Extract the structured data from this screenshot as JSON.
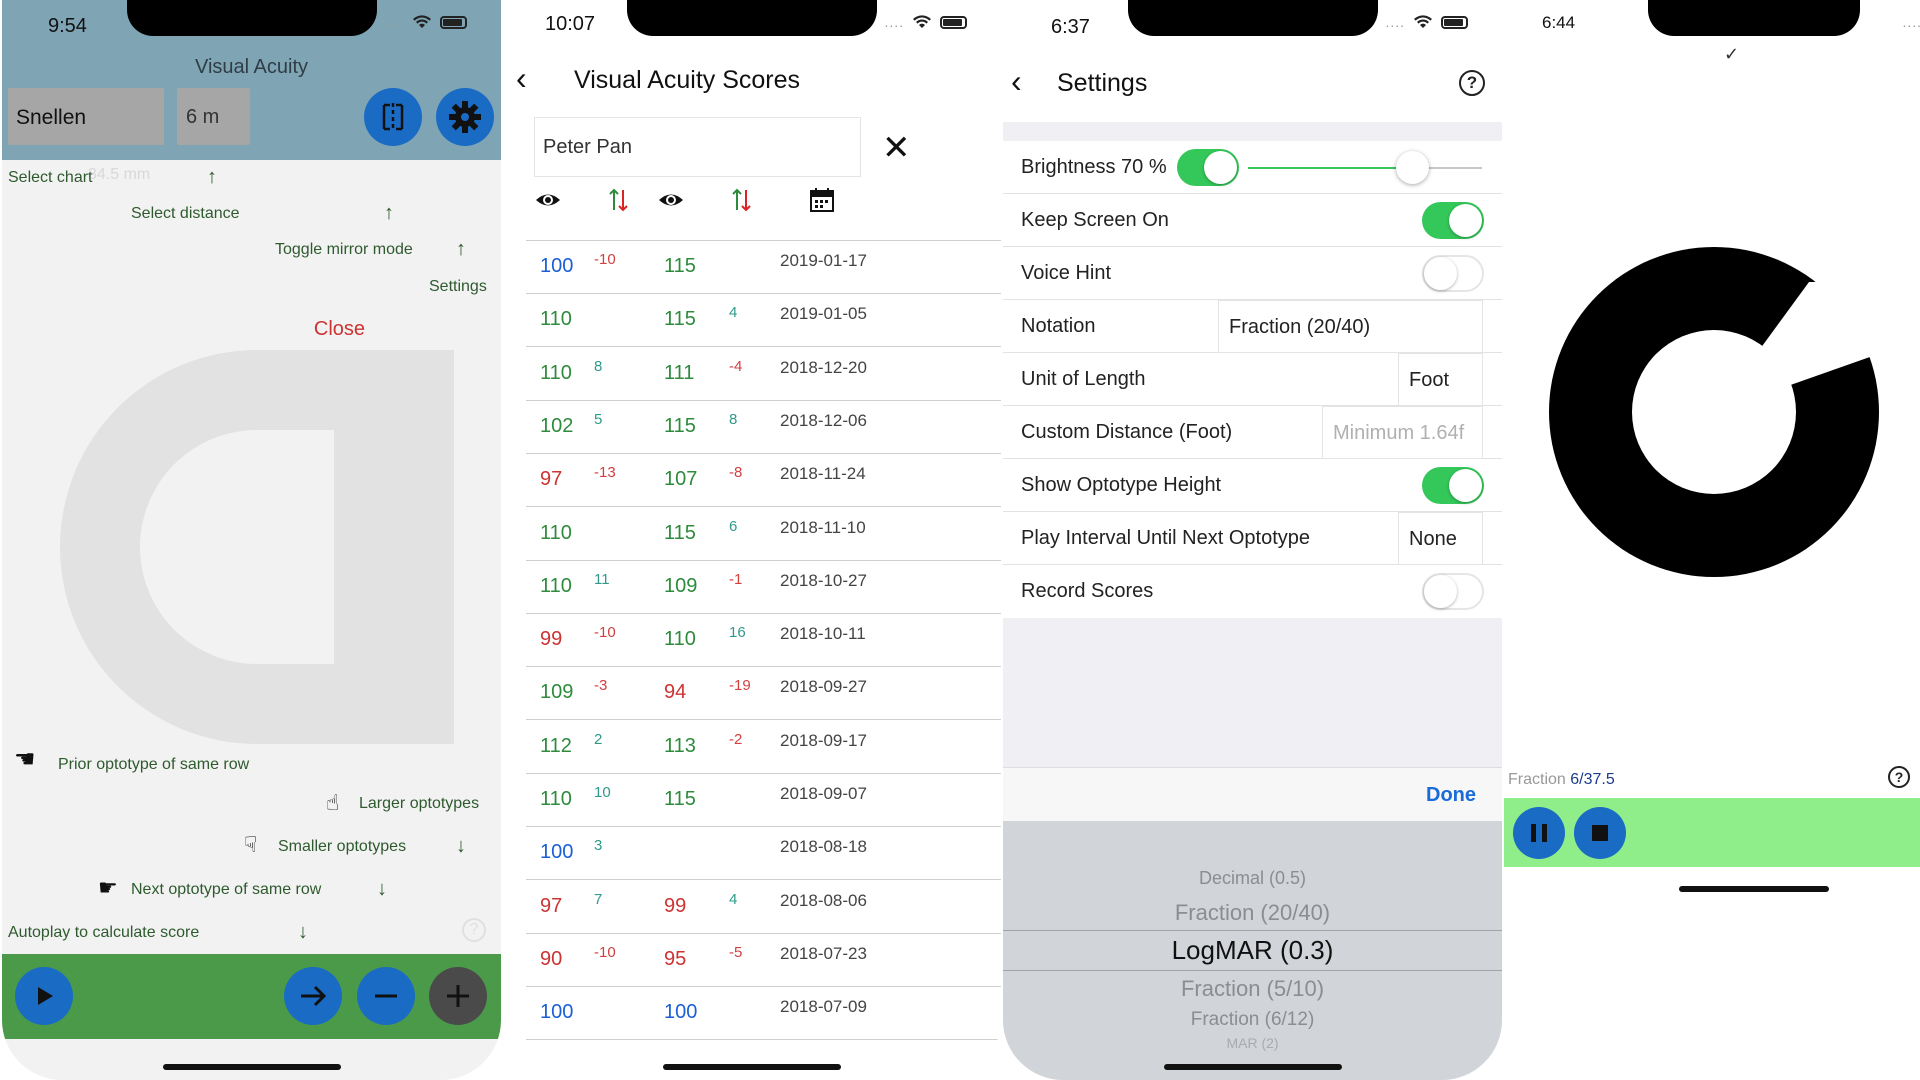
{
  "phone1": {
    "time": "9:54",
    "title": "Visual Acuity",
    "chart": "Snellen",
    "distance": "6 m",
    "hints": {
      "select_chart": "Select chart",
      "faded_size": "34.5 mm",
      "select_distance": "Select distance",
      "toggle_mirror": "Toggle mirror mode",
      "settings": "Settings",
      "close": "Close",
      "prior": "Prior optotype of same row",
      "larger": "Larger optotypes",
      "smaller": "Smaller optotypes",
      "next": "Next optotype of same row",
      "autoplay": "Autoplay to calculate score"
    },
    "icons": {
      "mirror": "mirror-toggle-icon",
      "settings": "gear-icon",
      "play": "play-icon",
      "next": "arrow-right-icon",
      "minus": "minus-icon",
      "plus": "plus-icon"
    },
    "colors": {
      "top_bar": "#7fa5b5",
      "bottom_bar": "#4a9a4a",
      "button": "#1a6bc4"
    }
  },
  "phone2": {
    "time": "10:07",
    "title": "Visual Acuity Scores",
    "patient_name": "Peter Pan",
    "column_icons": [
      "eye-icon",
      "change-arrows-icon",
      "eye-icon",
      "change-arrows-icon",
      "calendar-icon"
    ],
    "rows": [
      {
        "v1": "100",
        "c1": "blue",
        "d1": "-10",
        "dc1": "red",
        "v2": "115",
        "c2": "green",
        "d2": "",
        "dc2": "green",
        "date": "2019-01-17"
      },
      {
        "v1": "110",
        "c1": "green",
        "d1": "",
        "dc1": "green",
        "v2": "115",
        "c2": "green",
        "d2": "4",
        "dc2": "green",
        "date": "2019-01-05"
      },
      {
        "v1": "110",
        "c1": "green",
        "d1": "8",
        "dc1": "green",
        "v2": "111",
        "c2": "green",
        "d2": "-4",
        "dc2": "red",
        "date": "2018-12-20"
      },
      {
        "v1": "102",
        "c1": "green",
        "d1": "5",
        "dc1": "green",
        "v2": "115",
        "c2": "green",
        "d2": "8",
        "dc2": "green",
        "date": "2018-12-06"
      },
      {
        "v1": "97",
        "c1": "red",
        "d1": "-13",
        "dc1": "red",
        "v2": "107",
        "c2": "green",
        "d2": "-8",
        "dc2": "red",
        "date": "2018-11-24"
      },
      {
        "v1": "110",
        "c1": "green",
        "d1": "",
        "dc1": "green",
        "v2": "115",
        "c2": "green",
        "d2": "6",
        "dc2": "green",
        "date": "2018-11-10"
      },
      {
        "v1": "110",
        "c1": "green",
        "d1": "11",
        "dc1": "green",
        "v2": "109",
        "c2": "green",
        "d2": "-1",
        "dc2": "red",
        "date": "2018-10-27"
      },
      {
        "v1": "99",
        "c1": "red",
        "d1": "-10",
        "dc1": "red",
        "v2": "110",
        "c2": "green",
        "d2": "16",
        "dc2": "green",
        "date": "2018-10-11"
      },
      {
        "v1": "109",
        "c1": "green",
        "d1": "-3",
        "dc1": "red",
        "v2": "94",
        "c2": "red",
        "d2": "-19",
        "dc2": "red",
        "date": "2018-09-27"
      },
      {
        "v1": "112",
        "c1": "green",
        "d1": "2",
        "dc1": "green",
        "v2": "113",
        "c2": "green",
        "d2": "-2",
        "dc2": "red",
        "date": "2018-09-17"
      },
      {
        "v1": "110",
        "c1": "green",
        "d1": "10",
        "dc1": "green",
        "v2": "115",
        "c2": "green",
        "d2": "",
        "dc2": "green",
        "date": "2018-09-07"
      },
      {
        "v1": "100",
        "c1": "blue",
        "d1": "3",
        "dc1": "green",
        "v2": "",
        "c2": "green",
        "d2": "",
        "dc2": "green",
        "date": "2018-08-18"
      },
      {
        "v1": "97",
        "c1": "red",
        "d1": "7",
        "dc1": "green",
        "v2": "99",
        "c2": "red",
        "d2": "4",
        "dc2": "green",
        "date": "2018-08-06"
      },
      {
        "v1": "90",
        "c1": "red",
        "d1": "-10",
        "dc1": "red",
        "v2": "95",
        "c2": "red",
        "d2": "-5",
        "dc2": "red",
        "date": "2018-07-23"
      },
      {
        "v1": "100",
        "c1": "blue",
        "d1": "",
        "dc1": "green",
        "v2": "100",
        "c2": "blue",
        "d2": "",
        "dc2": "green",
        "date": "2018-07-09"
      }
    ]
  },
  "phone3": {
    "time": "6:37",
    "title": "Settings",
    "brightness_label": "Brightness 70 %",
    "brightness_value": 0.7,
    "keep_screen_on": "Keep Screen On",
    "voice_hint": "Voice Hint",
    "notation_label": "Notation",
    "notation_value": "Fraction (20/40)",
    "unit_label": "Unit of Length",
    "unit_value": "Foot",
    "custom_label": "Custom Distance (Foot)",
    "custom_placeholder": "Minimum 1.64f",
    "show_height": "Show Optotype Height",
    "play_interval": "Play Interval Until Next Optotype",
    "play_interval_value": "None",
    "record_scores": "Record Scores",
    "done": "Done",
    "picker": [
      "Decimal (0.5)",
      "Fraction (20/40)",
      "LogMAR (0.3)",
      "Fraction (5/10)",
      "Fraction (6/12)",
      "MAR (2)"
    ],
    "toggles": {
      "brightness": true,
      "keep_screen_on": true,
      "voice_hint": false,
      "show_height": true,
      "record_scores": false
    }
  },
  "phone4": {
    "time": "6:44",
    "check": "✓",
    "fraction_label": "Fraction",
    "fraction_value": "6/37.5",
    "icons": {
      "pause": "pause-icon",
      "stop": "stop-icon",
      "optotype": "landolt-c-icon"
    },
    "colors": {
      "bar": "#90ee8a"
    }
  }
}
